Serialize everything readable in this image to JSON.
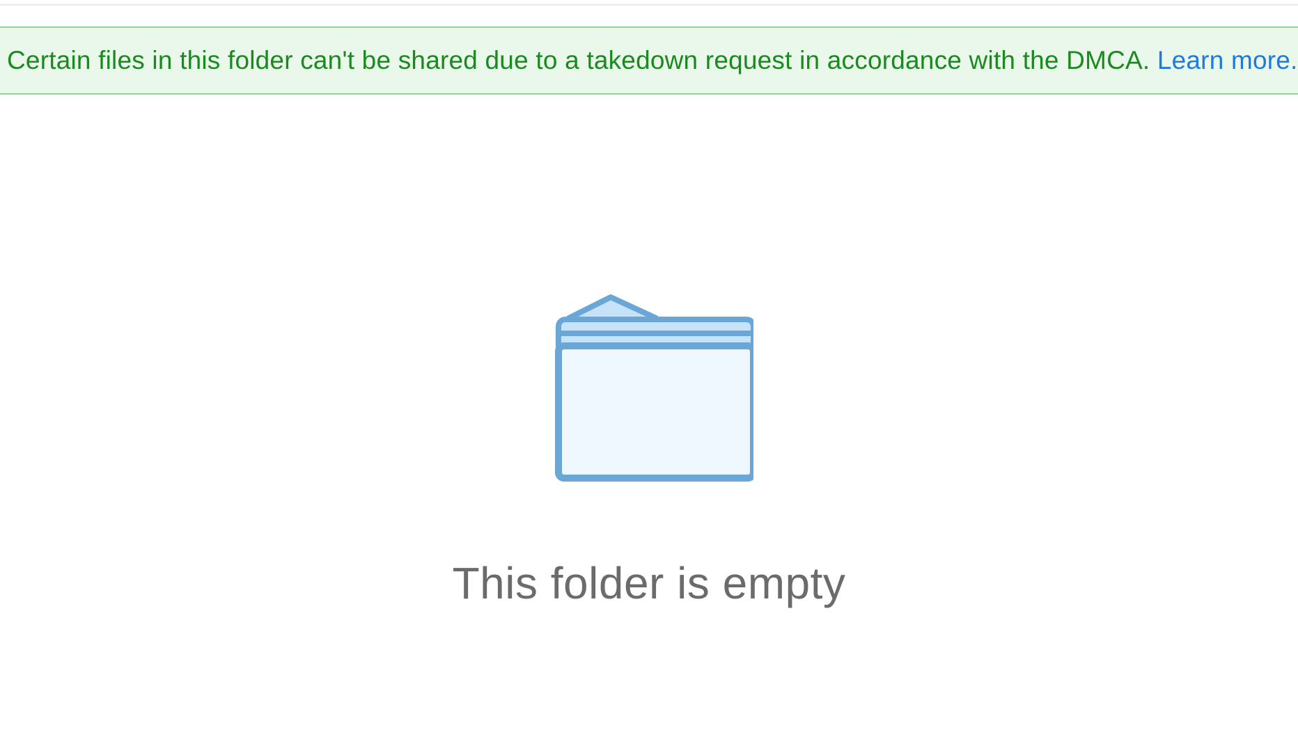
{
  "banner": {
    "message": "Certain files in this folder can't be shared due to a takedown request in accordance with the DMCA.",
    "link_label": "Learn more."
  },
  "empty_state": {
    "label": "This folder is empty"
  },
  "colors": {
    "banner_bg": "#e9f8ea",
    "banner_border": "#8fd694",
    "banner_text": "#1a8a1f",
    "link": "#1f7ae0",
    "empty_text": "#6b6b6b",
    "folder_stroke": "#6aa7d6",
    "folder_fill_top": "#c6e2f7",
    "folder_fill_body": "#eef7fd"
  }
}
